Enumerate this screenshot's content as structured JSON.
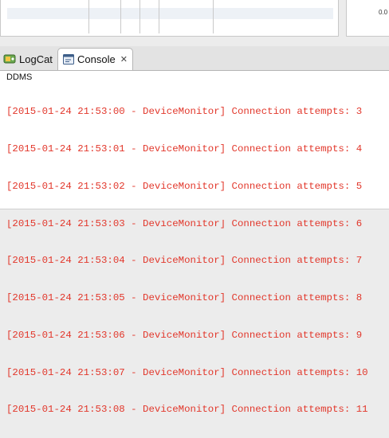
{
  "top_panel": {
    "value_text": "0.0"
  },
  "tabs": [
    {
      "label": "LogCat",
      "icon": "logcat-icon"
    },
    {
      "label": "Console",
      "icon": "console-icon",
      "close": "✕"
    }
  ],
  "console": {
    "title": "DDMS",
    "lines": [
      "[2015-01-24 21:53:00 - DeviceMonitor] Connection attempts: 3",
      "[2015-01-24 21:53:01 - DeviceMonitor] Connection attempts: 4",
      "[2015-01-24 21:53:02 - DeviceMonitor] Connection attempts: 5",
      "[2015-01-24 21:53:03 - DeviceMonitor] Connection attempts: 6",
      "[2015-01-24 21:53:04 - DeviceMonitor] Connection attempts: 7",
      "[2015-01-24 21:53:05 - DeviceMonitor] Connection attempts: 8",
      "[2015-01-24 21:53:06 - DeviceMonitor] Connection attempts: 9",
      "[2015-01-24 21:53:07 - DeviceMonitor] Connection attempts: 10",
      "[2015-01-24 21:53:08 - DeviceMonitor] Connection attempts: 11"
    ],
    "text_color": "#e2372b"
  }
}
